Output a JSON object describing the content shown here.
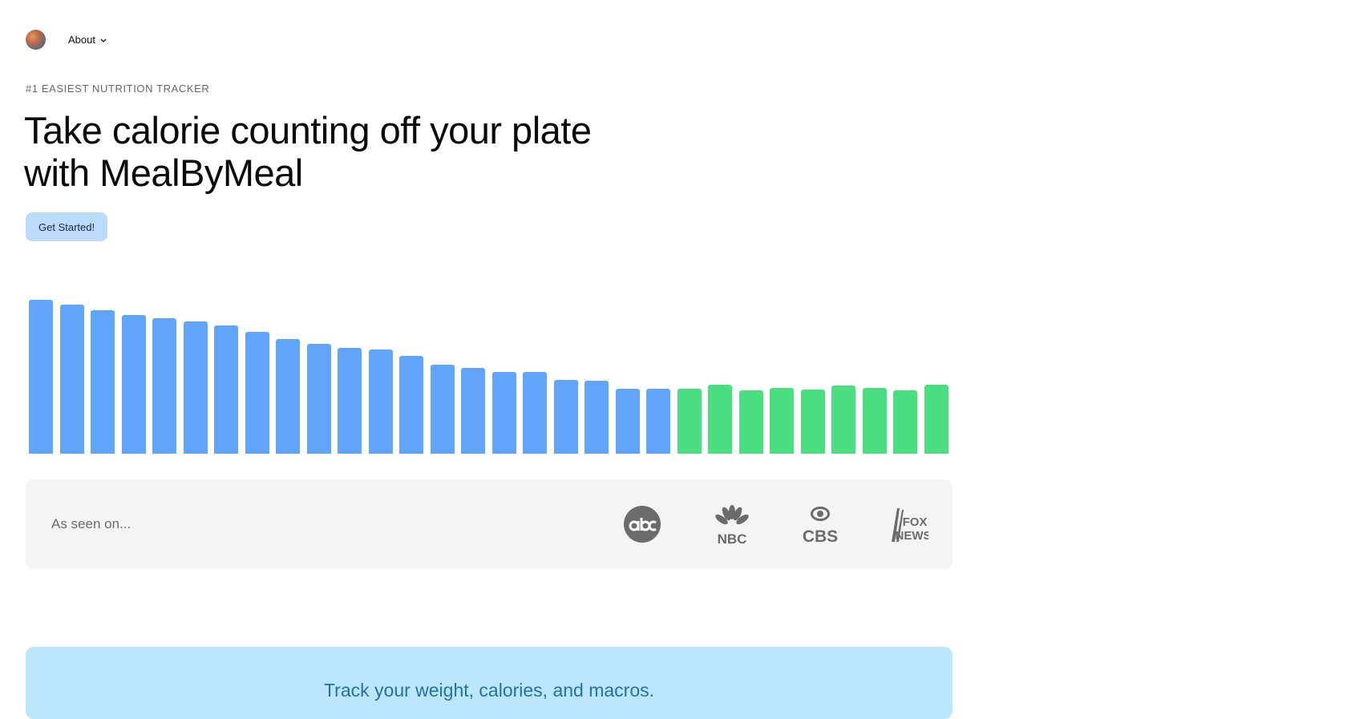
{
  "nav": {
    "about_label": "About"
  },
  "hero": {
    "eyebrow": "#1 EASIEST NUTRITION TRACKER",
    "headline": "Take calorie counting off your plate with MealByMeal",
    "cta_label": "Get Started!"
  },
  "chart_data": {
    "type": "bar",
    "values": [
      192,
      186,
      179,
      173,
      169,
      165,
      160,
      152,
      143,
      137,
      132,
      130,
      122,
      111,
      107,
      102,
      102,
      92,
      91,
      81,
      81,
      81,
      86,
      79,
      82,
      80,
      85,
      82,
      79,
      86
    ],
    "colors": [
      "#60a5fa",
      "#60a5fa",
      "#60a5fa",
      "#60a5fa",
      "#60a5fa",
      "#60a5fa",
      "#60a5fa",
      "#60a5fa",
      "#60a5fa",
      "#60a5fa",
      "#60a5fa",
      "#60a5fa",
      "#60a5fa",
      "#60a5fa",
      "#60a5fa",
      "#60a5fa",
      "#60a5fa",
      "#60a5fa",
      "#60a5fa",
      "#60a5fa",
      "#60a5fa",
      "#4ade80",
      "#4ade80",
      "#4ade80",
      "#4ade80",
      "#4ade80",
      "#4ade80",
      "#4ade80",
      "#4ade80",
      "#4ade80"
    ],
    "grid": false
  },
  "press": {
    "label": "As seen on...",
    "logos": [
      "abc-logo",
      "nbc-logo",
      "cbs-logo",
      "fox-news-logo"
    ]
  },
  "features": {
    "headline": "Track your weight, calories, and macros."
  },
  "colors": {
    "primary_bar": "#60a5fa",
    "goal_bar": "#4ade80",
    "cta_bg": "#bcdafc",
    "feature_bg": "#bce6fb",
    "feature_text": "#1f73a8"
  }
}
